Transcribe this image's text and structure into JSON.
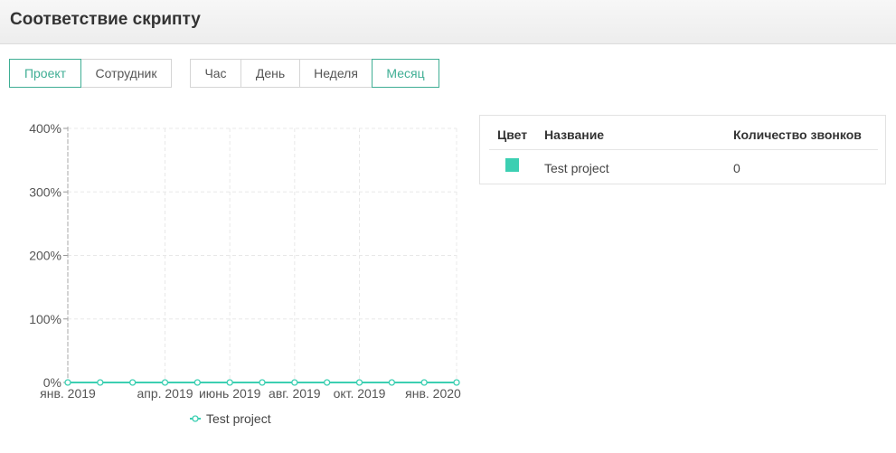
{
  "header": {
    "title": "Соответствие скрипту"
  },
  "group_tabs": [
    {
      "label": "Проект",
      "active": true
    },
    {
      "label": "Сотрудник",
      "active": false
    }
  ],
  "period_tabs": [
    {
      "label": "Час",
      "active": false
    },
    {
      "label": "День",
      "active": false
    },
    {
      "label": "Неделя",
      "active": false
    },
    {
      "label": "Месяц",
      "active": true
    }
  ],
  "colors": {
    "accent": "#3fae94",
    "series": "#3ccfb2"
  },
  "chart_data": {
    "type": "line",
    "x": [
      "2019-01",
      "2019-02",
      "2019-03",
      "2019-04",
      "2019-05",
      "2019-06",
      "2019-07",
      "2019-08",
      "2019-09",
      "2019-10",
      "2019-11",
      "2019-12",
      "2020-01"
    ],
    "x_tick_labels": [
      "янв. 2019",
      "апр. 2019",
      "июнь 2019",
      "авг. 2019",
      "окт. 2019",
      "янв. 2020"
    ],
    "y_tick_labels": [
      "0%",
      "100%",
      "200%",
      "300%",
      "400%"
    ],
    "ylim": [
      0,
      400
    ],
    "grid": true,
    "legend_position": "bottom",
    "series": [
      {
        "name": "Test project",
        "color": "#3ccfb2",
        "values": [
          0,
          0,
          0,
          0,
          0,
          0,
          0,
          0,
          0,
          0,
          0,
          0,
          0
        ]
      }
    ]
  },
  "table": {
    "headers": {
      "color": "Цвет",
      "name": "Название",
      "calls": "Количество звонков"
    },
    "rows": [
      {
        "color": "#3ccfb2",
        "name": "Test project",
        "calls": "0"
      }
    ]
  }
}
